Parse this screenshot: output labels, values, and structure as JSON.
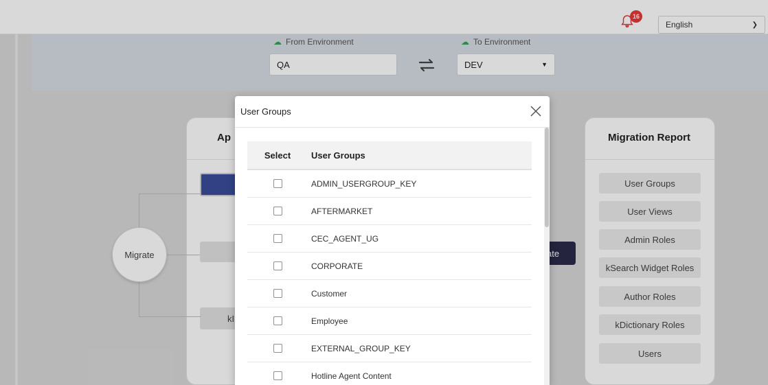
{
  "header": {
    "notification_count": "16",
    "language": "English"
  },
  "environment": {
    "from_label": "From Environment",
    "from_value": "QA",
    "to_label": "To Environment",
    "to_value": "DEV"
  },
  "left_card": {
    "title_partial": "Ap",
    "grey_btn2_partial": "kI"
  },
  "migrate_label": "Migrate",
  "dark_button_partial": "ate",
  "migration_report": {
    "title": "Migration Report",
    "items": [
      "User Groups",
      "User Views",
      "Admin Roles",
      "kSearch Widget Roles",
      "Author Roles",
      "kDictionary Roles",
      "Users"
    ]
  },
  "modal": {
    "title": "User Groups",
    "columns": {
      "select": "Select",
      "name": "User Groups"
    },
    "rows": [
      "ADMIN_USERGROUP_KEY",
      "AFTERMARKET",
      "CEC_AGENT_UG",
      "CORPORATE",
      "Customer",
      "Employee",
      "EXTERNAL_GROUP_KEY",
      "Hotline Agent Content"
    ]
  },
  "colors": {
    "accent_blue": "#3a4d9c",
    "dark_button": "#2b2b4a",
    "badge_red": "#e53935"
  }
}
